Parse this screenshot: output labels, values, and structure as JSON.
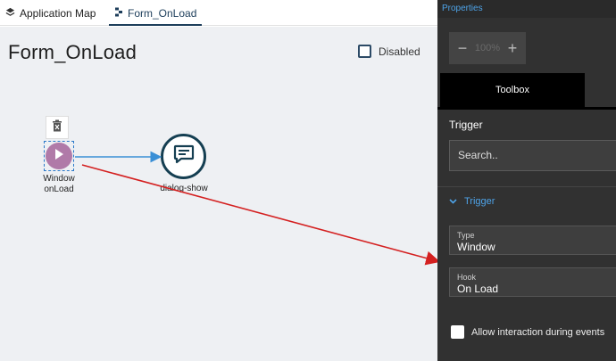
{
  "tabs": [
    {
      "label": "Application Map",
      "icon": "layers-icon"
    },
    {
      "label": "Form_OnLoad",
      "icon": "flow-icon",
      "active": true
    }
  ],
  "canvas": {
    "title": "Form_OnLoad",
    "disabled_label": "Disabled",
    "disabled_checked": false,
    "trigger_node": {
      "line1": "Window",
      "line2": "onLoad",
      "color": "#b07aa8"
    },
    "action_node": {
      "label": "dialog-show",
      "color": "#153f52"
    },
    "connector_color": "#3a8fd6",
    "annotation_arrow_color": "#d42020"
  },
  "panel": {
    "header": "Properties",
    "zoom": {
      "value": "100%",
      "minus": "−",
      "plus": "+"
    },
    "toolbox_tab": "Toolbox",
    "section_title": "Trigger",
    "search_placeholder": "Search..",
    "group_label": "Trigger",
    "fields": {
      "type": {
        "label": "Type",
        "value": "Window"
      },
      "hook": {
        "label": "Hook",
        "value": "On Load"
      }
    },
    "allow_label": "Allow interaction during events",
    "allow_checked": false,
    "accent": "#4ea3e8"
  }
}
